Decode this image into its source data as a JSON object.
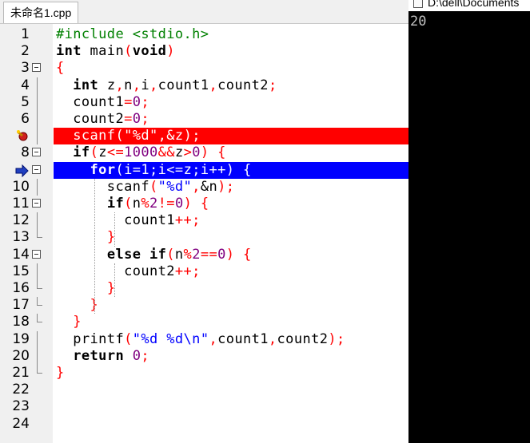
{
  "editor": {
    "tab_label": "未命名1.cpp",
    "line_numbers": [
      "1",
      "2",
      "3",
      "4",
      "5",
      "6",
      "7",
      "8",
      "9",
      "10",
      "11",
      "12",
      "13",
      "14",
      "15",
      "16",
      "17",
      "18",
      "19",
      "20",
      "21",
      "22",
      "23",
      "24"
    ],
    "lines": [
      [
        [
          "pp",
          "#include <stdio.h>"
        ]
      ],
      [
        [
          "kw",
          "int"
        ],
        [
          "tx",
          " main"
        ],
        [
          "op",
          "("
        ],
        [
          "kw",
          "void"
        ],
        [
          "op",
          ")"
        ]
      ],
      [
        [
          "op",
          "{"
        ]
      ],
      [
        [
          "tx",
          "  "
        ],
        [
          "kw",
          "int"
        ],
        [
          "tx",
          " z"
        ],
        [
          "op",
          ","
        ],
        [
          "tx",
          "n"
        ],
        [
          "op",
          ","
        ],
        [
          "tx",
          "i"
        ],
        [
          "op",
          ","
        ],
        [
          "tx",
          "count1"
        ],
        [
          "op",
          ","
        ],
        [
          "tx",
          "count2"
        ],
        [
          "op",
          ";"
        ]
      ],
      [
        [
          "tx",
          "  count1"
        ],
        [
          "op",
          "="
        ],
        [
          "num",
          "0"
        ],
        [
          "op",
          ";"
        ]
      ],
      [
        [
          "tx",
          "  count2"
        ],
        [
          "op",
          "="
        ],
        [
          "num",
          "0"
        ],
        [
          "op",
          ";"
        ]
      ],
      [
        [
          "tx",
          "  scanf"
        ],
        [
          "op",
          "("
        ],
        [
          "str",
          "\"%d\""
        ],
        [
          "op",
          ","
        ],
        [
          "tx",
          "&z"
        ],
        [
          "op",
          ");"
        ]
      ],
      [
        [
          "tx",
          "  "
        ],
        [
          "kw",
          "if"
        ],
        [
          "op",
          "("
        ],
        [
          "tx",
          "z"
        ],
        [
          "op",
          "<="
        ],
        [
          "num",
          "1000"
        ],
        [
          "op",
          "&&"
        ],
        [
          "tx",
          "z"
        ],
        [
          "op",
          ">"
        ],
        [
          "num",
          "0"
        ],
        [
          "op",
          ") {"
        ]
      ],
      [
        [
          "tx",
          "    "
        ],
        [
          "kw",
          "for"
        ],
        [
          "op",
          "("
        ],
        [
          "tx",
          "i"
        ],
        [
          "op",
          "="
        ],
        [
          "num",
          "1"
        ],
        [
          "op",
          ";"
        ],
        [
          "tx",
          "i"
        ],
        [
          "op",
          "<="
        ],
        [
          "tx",
          "z"
        ],
        [
          "op",
          ";"
        ],
        [
          "tx",
          "i"
        ],
        [
          "op",
          "++) {"
        ]
      ],
      [
        [
          "tx",
          "      scanf"
        ],
        [
          "op",
          "("
        ],
        [
          "str",
          "\"%d\""
        ],
        [
          "op",
          ","
        ],
        [
          "tx",
          "&n"
        ],
        [
          "op",
          ");"
        ]
      ],
      [
        [
          "tx",
          "      "
        ],
        [
          "kw",
          "if"
        ],
        [
          "op",
          "("
        ],
        [
          "tx",
          "n"
        ],
        [
          "op",
          "%"
        ],
        [
          "num",
          "2"
        ],
        [
          "op",
          "!="
        ],
        [
          "num",
          "0"
        ],
        [
          "op",
          ") {"
        ]
      ],
      [
        [
          "tx",
          "        count1"
        ],
        [
          "op",
          "++;"
        ]
      ],
      [
        [
          "tx",
          "      "
        ],
        [
          "op",
          "}"
        ]
      ],
      [
        [
          "tx",
          "      "
        ],
        [
          "kw",
          "else if"
        ],
        [
          "op",
          "("
        ],
        [
          "tx",
          "n"
        ],
        [
          "op",
          "%"
        ],
        [
          "num",
          "2"
        ],
        [
          "op",
          "=="
        ],
        [
          "num",
          "0"
        ],
        [
          "op",
          ") {"
        ]
      ],
      [
        [
          "tx",
          "        count2"
        ],
        [
          "op",
          "++;"
        ]
      ],
      [
        [
          "tx",
          "      "
        ],
        [
          "op",
          "}"
        ]
      ],
      [
        [
          "tx",
          "    "
        ],
        [
          "op",
          "}"
        ]
      ],
      [
        [
          "tx",
          "  "
        ],
        [
          "op",
          "}"
        ]
      ],
      [
        [
          "tx",
          "  printf"
        ],
        [
          "op",
          "("
        ],
        [
          "str",
          "\"%d %d\\n\""
        ],
        [
          "op",
          ","
        ],
        [
          "tx",
          "count1"
        ],
        [
          "op",
          ","
        ],
        [
          "tx",
          "count2"
        ],
        [
          "op",
          ");"
        ]
      ],
      [
        [
          "tx",
          "  "
        ],
        [
          "kw",
          "return"
        ],
        [
          "tx",
          " "
        ],
        [
          "num",
          "0"
        ],
        [
          "op",
          ";"
        ]
      ],
      [
        [
          "op",
          "}"
        ]
      ],
      [],
      [],
      []
    ],
    "breakpoint_line": 7,
    "current_exec_line": 9
  },
  "console": {
    "title": "D:\\dell\\Documents",
    "output": "20"
  }
}
